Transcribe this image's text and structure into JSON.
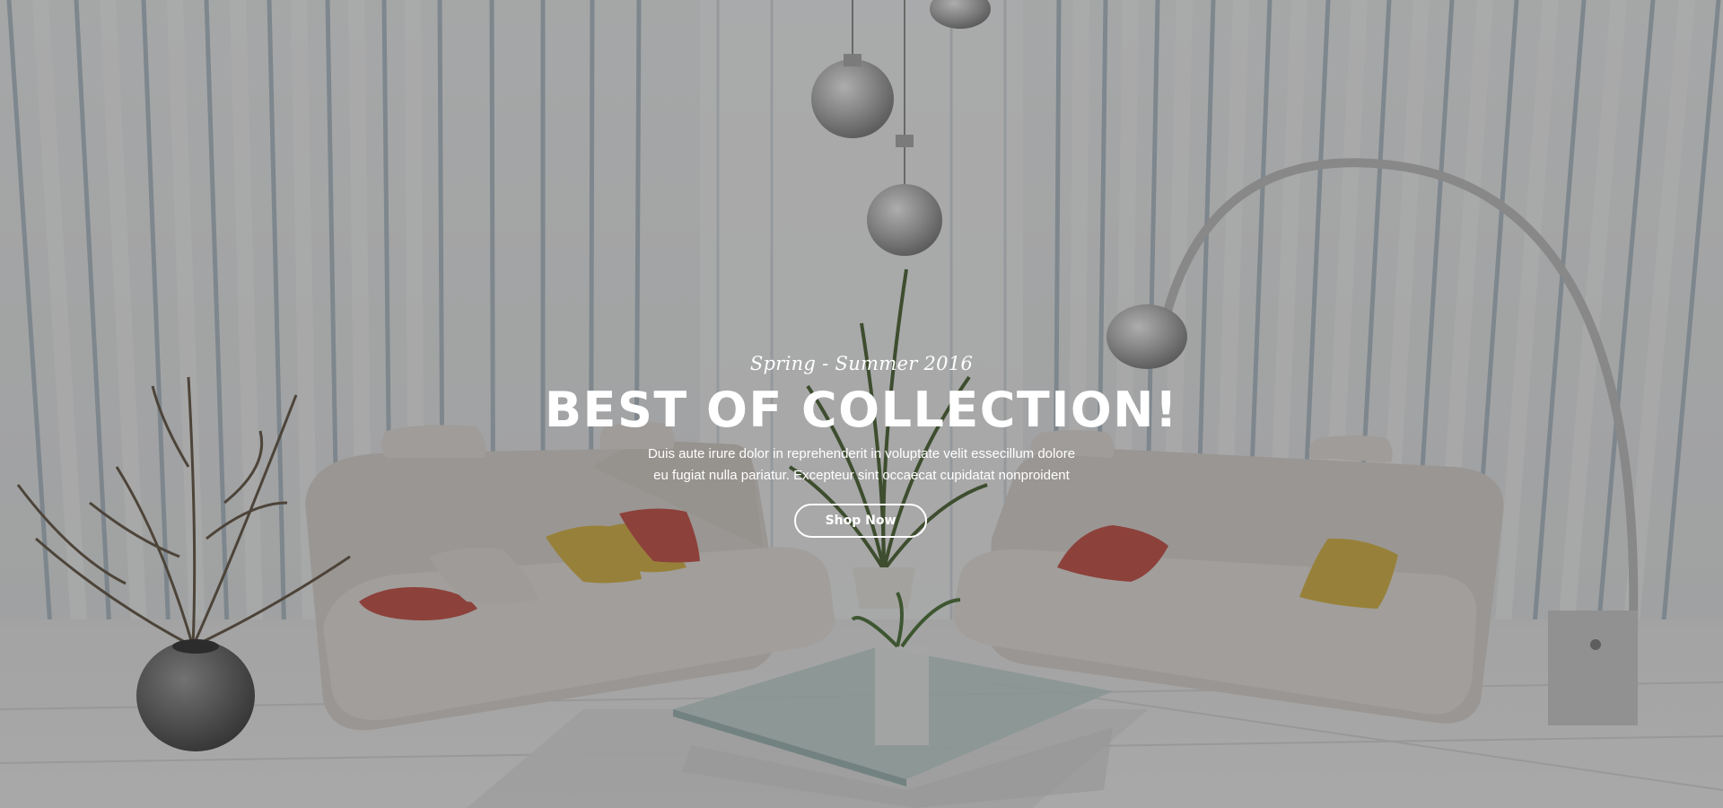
{
  "hero": {
    "subtitle": "Spring - Summer 2016",
    "title": "BEST OF COLLECTION!",
    "description_line1": "Duis aute irure dolor in reprehenderit in voluptate velit essecillum dolore",
    "description_line2": "eu fugiat nulla pariatur. Excepteur sint occaecat cupidatat nonproident",
    "cta_label": "Shop Now"
  },
  "colors": {
    "text": "#ffffff",
    "overlay": "rgba(60,60,60,0.42)",
    "cushion_red": "#c8463c",
    "cushion_yellow": "#d9b43a"
  }
}
